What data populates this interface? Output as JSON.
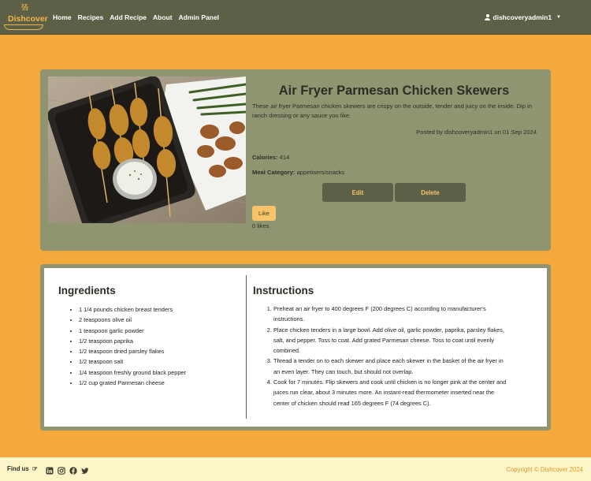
{
  "brand": {
    "logo_text": "Dishcover"
  },
  "nav": {
    "links": [
      "Home",
      "Recipes",
      "Add Recipe",
      "About",
      "Admin Panel"
    ],
    "user": "dishcoveryadmin1"
  },
  "recipe": {
    "title": "Air Fryer Parmesan Chicken Skewers",
    "description": "These air fryer Parmesan chicken skewers are crispy on the outside, tender and juicy on the inside. Dip in ranch dressing or any sauce you like.",
    "posted": "Posted by dishcoveryadmin1 on 01 Sep 2024",
    "calories_label": "Calories:",
    "calories_value": "414",
    "category_label": "Meal Category:",
    "category_value": "appetisers/snacks",
    "edit_label": "Edit",
    "delete_label": "Delete",
    "like_label": "Like",
    "likes": "0 likes"
  },
  "ingredients": {
    "title": "Ingredients",
    "items": [
      "1 1/4 pounds chicken breast tenders",
      "2 teaspoons olive oil",
      "1 teaspoon garlic powder",
      "1/2 teaspoon paprika",
      "1/2 teaspoon dried parsley flakes",
      "1/2 teaspoon salt",
      "1/4 teaspoon freshly ground black pepper",
      "1/2 cup grated Parmesan cheese"
    ]
  },
  "instructions": {
    "title": "Instructions",
    "steps": [
      "Preheat an air fryer to 400 degrees F (200 degrees C) according to manufacturer's instructions.",
      "Place chicken tenders in a large bowl. Add olive oil, garlic powder, paprika, parsley flakes, salt, and pepper. Toss to coat. Add grated Parmesan cheese. Toss to coat until evenly combined.",
      "Thread a tender on to each skewer and place each skewer in the basket of the air fryer in an even layer. They can touch, but should not overlap.",
      "Cook for 7 minutes. Flip skewers and cook until chicken is no longer pink at the center and juices run clear, about 3 minutes more. An instant-read thermometer inserted near the center of chicken should read 165 degrees F (74 degrees C)."
    ]
  },
  "footer": {
    "find_us": "Find us",
    "social_icons": [
      "linkedin-icon",
      "instagram-icon",
      "facebook-icon",
      "twitter-icon"
    ],
    "copyright": "Copyright © Dishcover 2024"
  },
  "colors": {
    "page_bg": "#f6a93b",
    "navbar": "#5d6047",
    "card": "#8f9471",
    "button_text": "#f6c56b",
    "like_button": "#f8c46a",
    "footer_bg": "#fcf5c7",
    "copyright": "#e39a2c"
  }
}
